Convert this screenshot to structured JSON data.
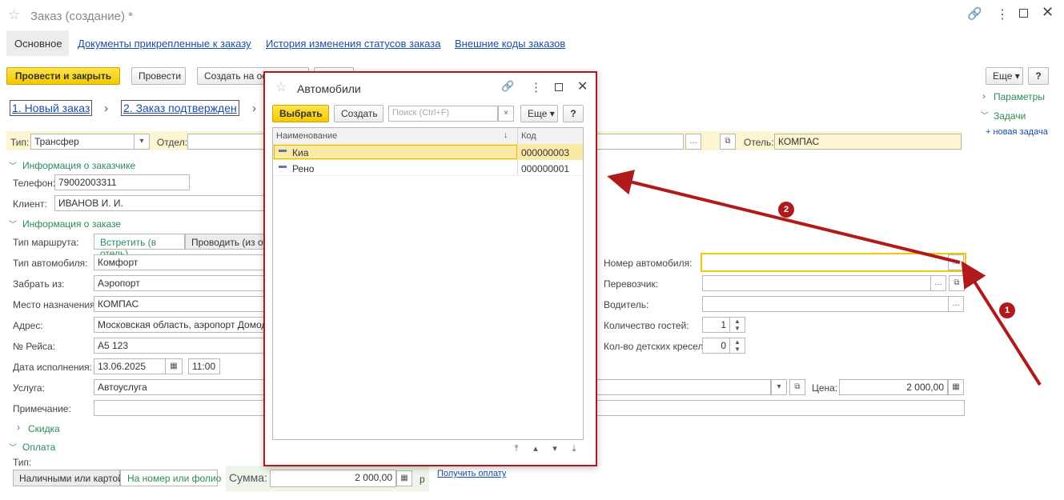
{
  "window": {
    "title": "Заказ (создание) *"
  },
  "tabs": [
    "Основное",
    "Документы прикрепленные к заказу",
    "История изменения статусов заказа",
    "Внешние коды заказов"
  ],
  "toolbar": {
    "post_close": "Провести и закрыть",
    "post": "Провести",
    "create_based": "Создать на ос",
    "more": "Еще",
    "help": "?"
  },
  "status_steps": [
    "1. Новый заказ",
    "2. Заказ подтвержден"
  ],
  "right_panel": {
    "params": "Параметры",
    "tasks": "Задачи",
    "new_task": "+ новая задача"
  },
  "top_row": {
    "type_label": "Тип:",
    "type_value": "Трансфер",
    "dept_label": "Отдел:",
    "hotel_label": "Отель:",
    "hotel_value": "КОМПАС"
  },
  "customer": {
    "section": "Информация о заказчике",
    "phone_label": "Телефон:",
    "phone_value": "79002003311",
    "client_label": "Клиент:",
    "client_value": "ИВАНОВ И. И."
  },
  "order": {
    "section": "Информация о заказе",
    "route_label": "Тип маршрута:",
    "route_opt1": "Встретить (в отель)",
    "route_opt2": "Проводить (из оте",
    "car_type_label": "Тип автомобиля:",
    "car_type_value": "Комфорт",
    "pickup_label": "Забрать из:",
    "pickup_value": "Аэропорт",
    "dest_label": "Место назначения:",
    "dest_value": "КОМПАС",
    "address_label": "Адрес:",
    "address_value": "Московская область, аэропорт Домодед",
    "flight_label": "№ Рейса:",
    "flight_value": "А5 123",
    "date_label": "Дата исполнения:",
    "date_value": "13.06.2025",
    "time_value": "11:00",
    "service_label": "Услуга:",
    "service_value": "Автоуслуга",
    "note_label": "Примечание:",
    "car_number_label": "Номер автомобиля:",
    "carrier_label": "Перевозчик:",
    "driver_label": "Водитель:",
    "guests_label": "Количество гостей:",
    "guests_value": "1",
    "child_seats_label": "Кол-во детских кресел:",
    "child_seats_value": "0",
    "price_label": "Цена:",
    "price_value": "2 000,00"
  },
  "discount": {
    "section": "Скидка"
  },
  "payment": {
    "section": "Оплата",
    "type_label": "Тип:",
    "opt1": "Наличными или картой",
    "opt2": "На номер или фолио",
    "sum_label": "Сумма:",
    "sum_value": "2 000,00",
    "currency": "р",
    "get_payment": "Получить оплату"
  },
  "dialog": {
    "title": "Автомобили",
    "select": "Выбрать",
    "create": "Создать",
    "search_placeholder": "Поиск (Ctrl+F)",
    "more": "Еще",
    "help": "?",
    "col_name": "Наименование",
    "col_code": "Код",
    "rows": [
      {
        "name": "Киа",
        "code": "000000003"
      },
      {
        "name": "Рено",
        "code": "000000001"
      }
    ]
  },
  "annotations": [
    "1",
    "2"
  ],
  "colors": {
    "accent_yellow": "#f5c800",
    "link_blue": "#1a4ea6",
    "section_green": "#2d8a55",
    "arrow_red": "#b01a1a"
  }
}
